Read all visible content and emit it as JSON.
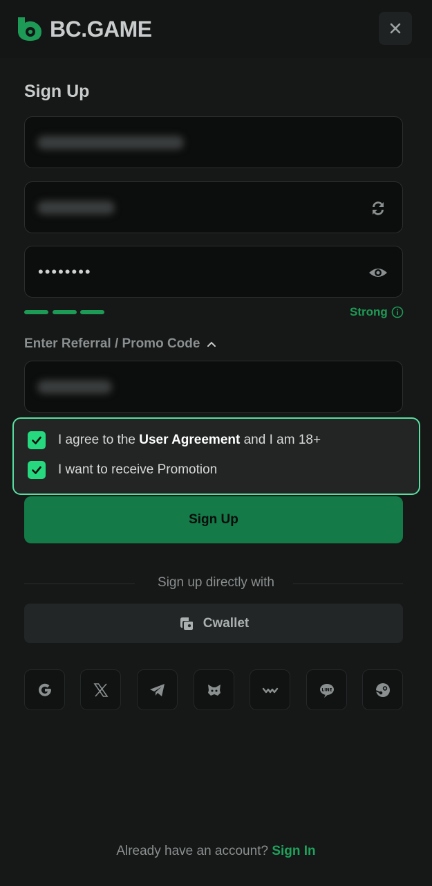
{
  "header": {
    "logo_text": "BC.GAME",
    "close_icon": "close-icon"
  },
  "form": {
    "title": "Sign Up",
    "email_field": {
      "value": "",
      "note": ""
    },
    "username_field": {
      "value": ""
    },
    "password_field": {
      "value": "••••••••"
    },
    "password_strength": {
      "label": "Strong",
      "level": 3,
      "max": 3
    },
    "promo": {
      "toggle_label": "Enter Referral / Promo Code",
      "value": ""
    },
    "agreements": [
      {
        "checked": true,
        "prefix": "I agree to the ",
        "link": "User Agreement",
        "suffix": " and I am 18+"
      },
      {
        "checked": true,
        "text": "I want to receive Promotion"
      }
    ],
    "submit_label": "Sign Up"
  },
  "alt_signup": {
    "divider_text": "Sign up directly with",
    "cwallet_label": "Cwallet",
    "socials": [
      "google-icon",
      "x-icon",
      "telegram-icon",
      "metamask-icon",
      "walletconnect-icon",
      "line-icon",
      "steam-icon"
    ]
  },
  "footer": {
    "prompt": "Already have an account? ",
    "signin_label": "Sign In"
  },
  "colors": {
    "accent": "#1d9a55",
    "checkbox": "#26d97e",
    "highlight_border": "#58e0a0",
    "button": "#137a48"
  }
}
